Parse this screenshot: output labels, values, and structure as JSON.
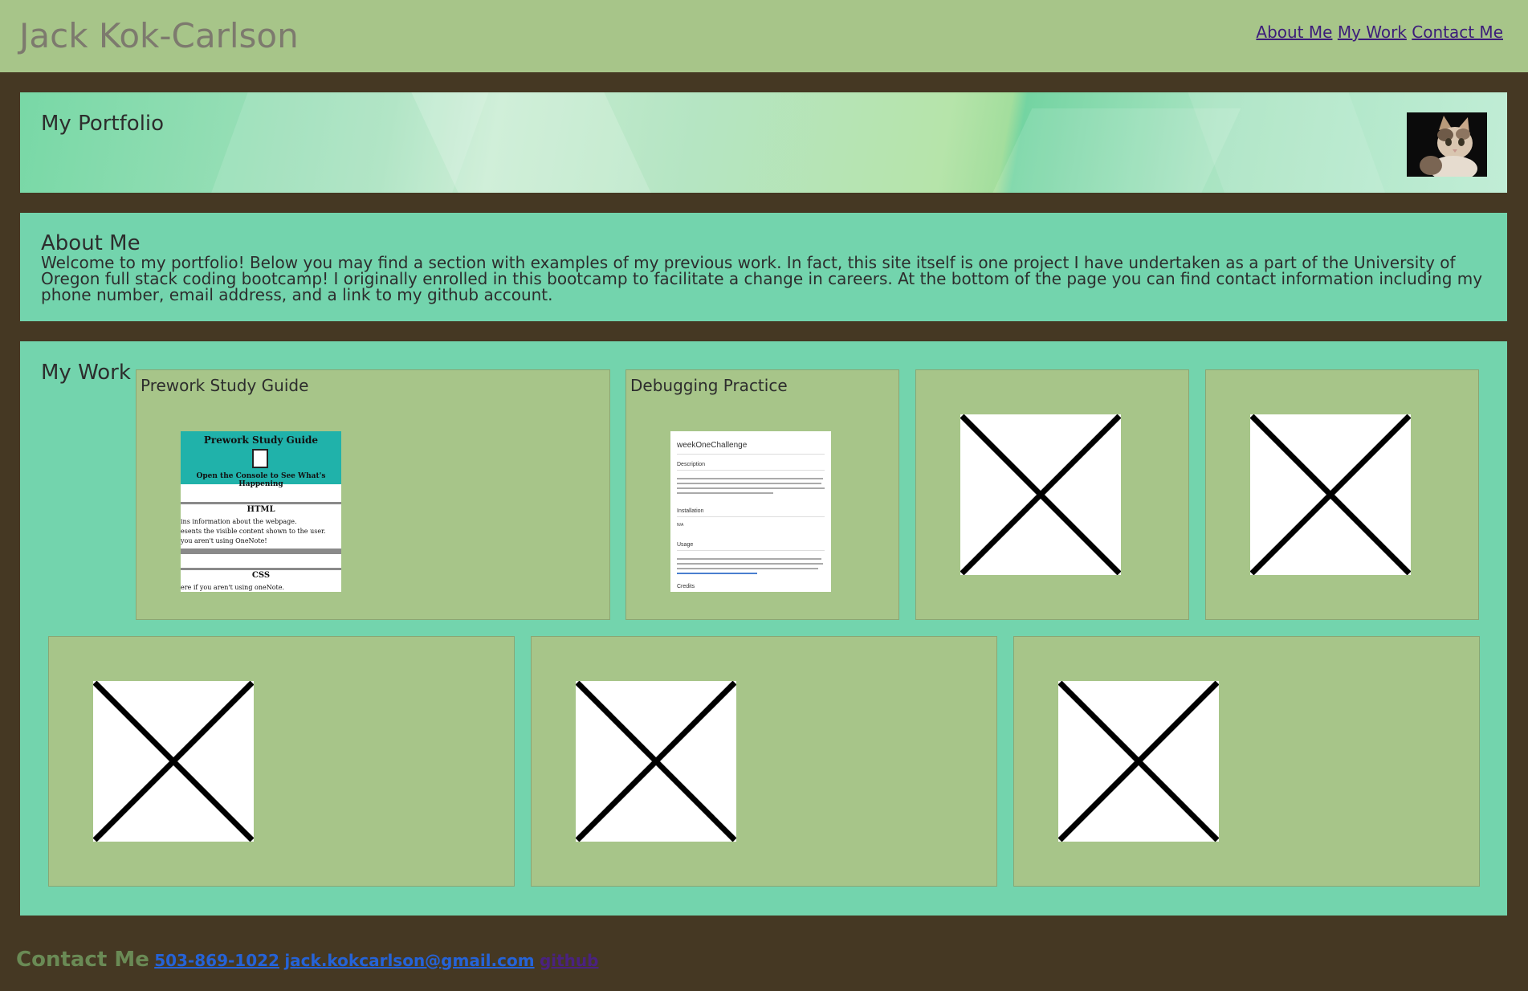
{
  "header": {
    "site_title": "Jack Kok-Carlson",
    "nav": [
      {
        "label": "About Me"
      },
      {
        "label": "My Work"
      },
      {
        "label": "Contact Me"
      }
    ]
  },
  "hero": {
    "title": "My Portfolio",
    "avatar": "cat-photo"
  },
  "about": {
    "title": "About Me",
    "text": "Welcome to my portfolio! Below you may find a section with examples of my previous work. In fact, this site itself is one project I have undertaken as a part of the University of Oregon full stack coding bootcamp! I originally enrolled in this bootcamp to facilitate a change in careers. At the bottom of the page you can find contact information including my phone number, email address, and a link to my github account."
  },
  "work": {
    "title": "My Work",
    "projects": [
      {
        "title": "Prework Study Guide",
        "thumb": {
          "heading": "Prework Study Guide",
          "subheading": "Open the Console to See What's Happening",
          "section1": "HTML",
          "lines1": [
            "ins information about the webpage.",
            "esents the visible content shown to the user.",
            "you aren't using OneNote!"
          ],
          "section2": "CSS",
          "lines2": [
            "ere if you aren't using oneNote."
          ]
        }
      },
      {
        "title": "Debugging Practice",
        "thumb": {
          "heading": "weekOneChallenge",
          "sections": [
            "Description",
            "Installation",
            "Usage",
            "Credits"
          ],
          "na": "N/A"
        }
      },
      {
        "title": "",
        "thumb": "placeholder-image"
      },
      {
        "title": "",
        "thumb": "placeholder-image"
      },
      {
        "title": "",
        "thumb": "placeholder-image"
      },
      {
        "title": "",
        "thumb": "placeholder-image"
      },
      {
        "title": "",
        "thumb": "placeholder-image"
      }
    ]
  },
  "footer": {
    "title": "Contact Me",
    "phone": "503-869-1022",
    "email": "jack.kokcarlson@gmail.com",
    "github": "github"
  },
  "colors": {
    "background": "#453823",
    "header": "#a7c589",
    "section": "#73d4ad",
    "card": "#a7c589",
    "nav_link": "#3c1c7a",
    "contact_link": "#2563d8",
    "contact_title": "#6a8a55"
  }
}
